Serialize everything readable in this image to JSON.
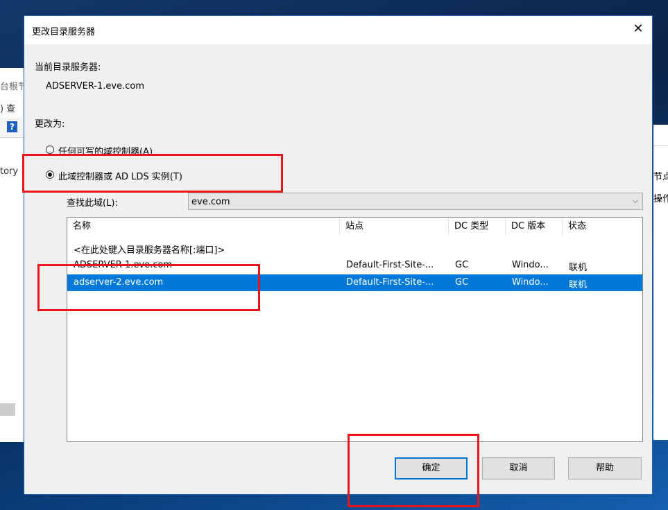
{
  "background_windows": {
    "left_fragments": [
      "台根节",
      ")  查",
      "tory"
    ],
    "right_fragments": [
      "节点",
      "操作"
    ]
  },
  "dialog": {
    "title": "更改目录服务器",
    "close_glyph": "✕",
    "current_label": "当前目录服务器:",
    "current_value": "ADSERVER-1.eve.com",
    "change_to_label": "更改为:",
    "option_any": "任何可写的域控制器(A)",
    "option_this": "此域控制器或 AD LDS 实例(T)",
    "selected_option": "this",
    "domain_label": "查找此域(L):",
    "domain_value": "eve.com",
    "domain_arrow": "⌵",
    "columns": [
      "名称",
      "站点",
      "DC 类型",
      "DC 版本",
      "状态"
    ],
    "placeholder_row": "<在此处键入目录服务器名称[:端口]>",
    "rows": [
      {
        "name": "ADSERVER-1.eve.com",
        "site": "Default-First-Site-...",
        "dc_type": "GC",
        "dc_version": "Windo...",
        "status": "联机",
        "selected": false
      },
      {
        "name": "adserver-2.eve.com",
        "site": "Default-First-Site-...",
        "dc_type": "GC",
        "dc_version": "Windo...",
        "status": "联机",
        "selected": true
      }
    ],
    "buttons": {
      "ok": "确定",
      "cancel": "取消",
      "help": "帮助"
    }
  },
  "colors": {
    "accent": "#0078d7",
    "annotation": "#e8141a"
  }
}
